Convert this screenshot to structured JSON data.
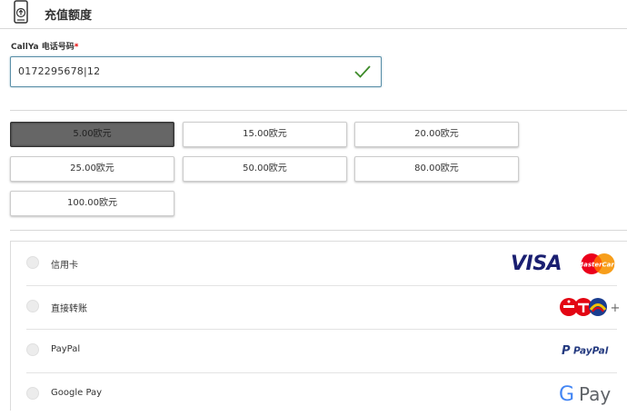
{
  "header": {
    "title": "充值额度"
  },
  "phone": {
    "label": "CallYa 电话号码",
    "required_mark": "*",
    "value": "0172295678|12"
  },
  "amounts": [
    {
      "label": "5.00欧元",
      "selected": true
    },
    {
      "label": "15.00欧元",
      "selected": false
    },
    {
      "label": "20.00欧元",
      "selected": false
    },
    {
      "label": "25.00欧元",
      "selected": false
    },
    {
      "label": "50.00欧元",
      "selected": false
    },
    {
      "label": "80.00欧元",
      "selected": false
    },
    {
      "label": "100.00欧元",
      "selected": false
    }
  ],
  "payment_methods": [
    {
      "label": "信用卡",
      "logos": [
        "VISA",
        "MasterCard"
      ]
    },
    {
      "label": "直接转账",
      "logos": [
        "sofort-icon",
        "+"
      ]
    },
    {
      "label": "PayPal",
      "logos": [
        "P",
        "PayPal"
      ]
    },
    {
      "label": "Google Pay",
      "logos": [
        "G",
        "Pay"
      ]
    }
  ],
  "colors": {
    "accent_border": "#5a8fa8",
    "check_green": "#3c8a28",
    "selected_bg": "#666666",
    "visa_blue": "#1a1f71",
    "paypal_dark": "#253b80",
    "paypal_light": "#179bd7",
    "mastercard_red": "#eb001b",
    "mastercard_orange": "#f79e1b"
  }
}
